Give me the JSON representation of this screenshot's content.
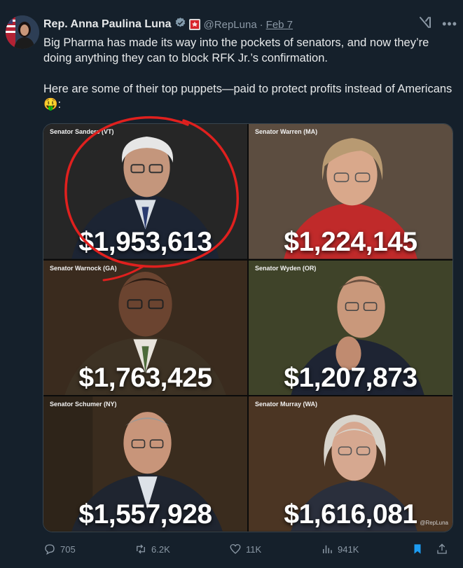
{
  "author": {
    "name": "Rep. Anna Paulina Luna",
    "handle": "@RepLuna",
    "separator": "·",
    "date": "Feb 7"
  },
  "tweet": {
    "paragraph1": "Big Pharma has made its way into the pockets of senators, and now they’re doing anything they can to block RFK Jr.’s confirmation.",
    "paragraph2": "Here are some of their top puppets—paid to protect profits instead of Americans 🤑:"
  },
  "grid": {
    "cells": [
      {
        "label": "Senator Sanders (VT)",
        "amount": "$1,953,613",
        "bg": "#2b2b2b"
      },
      {
        "label": "Senator Warren (MA)",
        "amount": "$1,224,145",
        "bg": "#5a4a3c"
      },
      {
        "label": "Senator Warnock (GA)",
        "amount": "$1,763,425",
        "bg": "#3b2a1d"
      },
      {
        "label": "Senator Wyden (OR)",
        "amount": "$1,207,873",
        "bg": "#3e4228"
      },
      {
        "label": "Senator Schumer (NY)",
        "amount": "$1,557,928",
        "bg": "#3a2a1c"
      },
      {
        "label": "Senator Murray (WA)",
        "amount": "$1,616,081",
        "bg": "#4a3522"
      }
    ],
    "watermark": "@RepLuna"
  },
  "actions": {
    "replies": "705",
    "reposts": "6.2K",
    "likes": "11K",
    "views": "941K"
  },
  "colors": {
    "background": "#15202b",
    "verified": "#829aab",
    "bookmark": "#1d9bf0",
    "circle": "#e0201e"
  }
}
